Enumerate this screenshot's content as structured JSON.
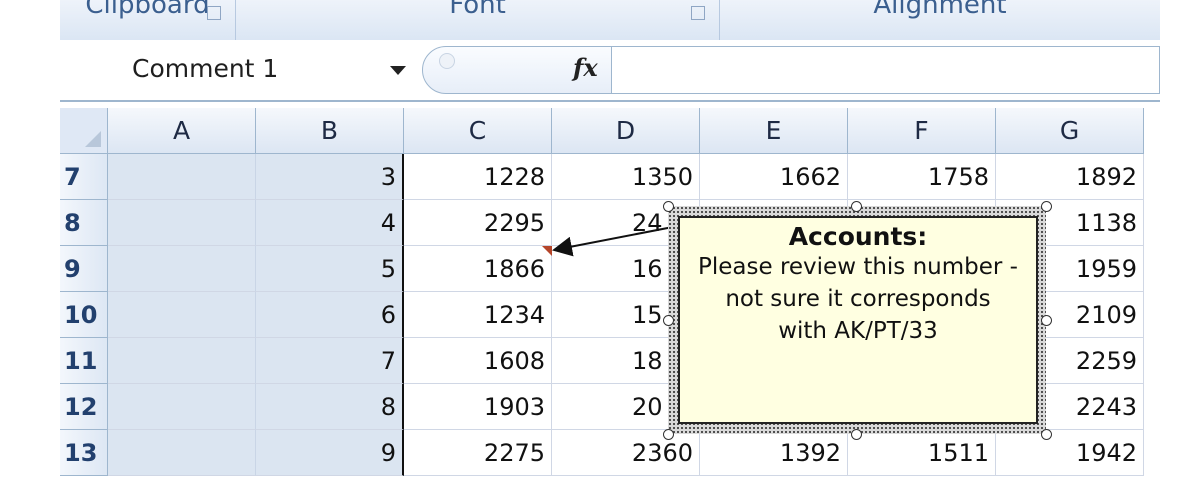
{
  "ribbon": {
    "groups": [
      "Clipboard",
      "Font",
      "Alignment"
    ]
  },
  "formula_bar": {
    "name_box": "Comment 1",
    "fx_label": "fx",
    "formula_value": ""
  },
  "sheet": {
    "columns": [
      "A",
      "B",
      "C",
      "D",
      "E",
      "F",
      "G"
    ],
    "rows": [
      {
        "num": "7",
        "A": "",
        "B": "3",
        "C": "1228",
        "D": "1350",
        "E": "1662",
        "F": "1758",
        "G": "1892"
      },
      {
        "num": "8",
        "A": "",
        "B": "4",
        "C": "2295",
        "D": "24",
        "E": "",
        "F": "",
        "G": "1138"
      },
      {
        "num": "9",
        "A": "",
        "B": "5",
        "C": "1866",
        "D": "16",
        "E": "",
        "F": "",
        "G": "1959"
      },
      {
        "num": "10",
        "A": "",
        "B": "6",
        "C": "1234",
        "D": "15",
        "E": "",
        "F": "",
        "G": "2109"
      },
      {
        "num": "11",
        "A": "",
        "B": "7",
        "C": "1608",
        "D": "18",
        "E": "",
        "F": "",
        "G": "2259"
      },
      {
        "num": "12",
        "A": "",
        "B": "8",
        "C": "1903",
        "D": "20",
        "E": "",
        "F": "",
        "G": "2243"
      },
      {
        "num": "13",
        "A": "",
        "B": "9",
        "C": "2275",
        "D": "2360",
        "E": "1392",
        "F": "1511",
        "G": "1942"
      }
    ]
  },
  "comment": {
    "author": "Accounts:",
    "lines": [
      "Please review this number -",
      "not sure it corresponds",
      "with AK/PT/33"
    ]
  },
  "colors": {
    "header_bg": "#dce6f3",
    "comment_bg": "#ffffe1",
    "comment_indicator": "#b5452a",
    "selected_column_shade": "#dbe5f1"
  }
}
